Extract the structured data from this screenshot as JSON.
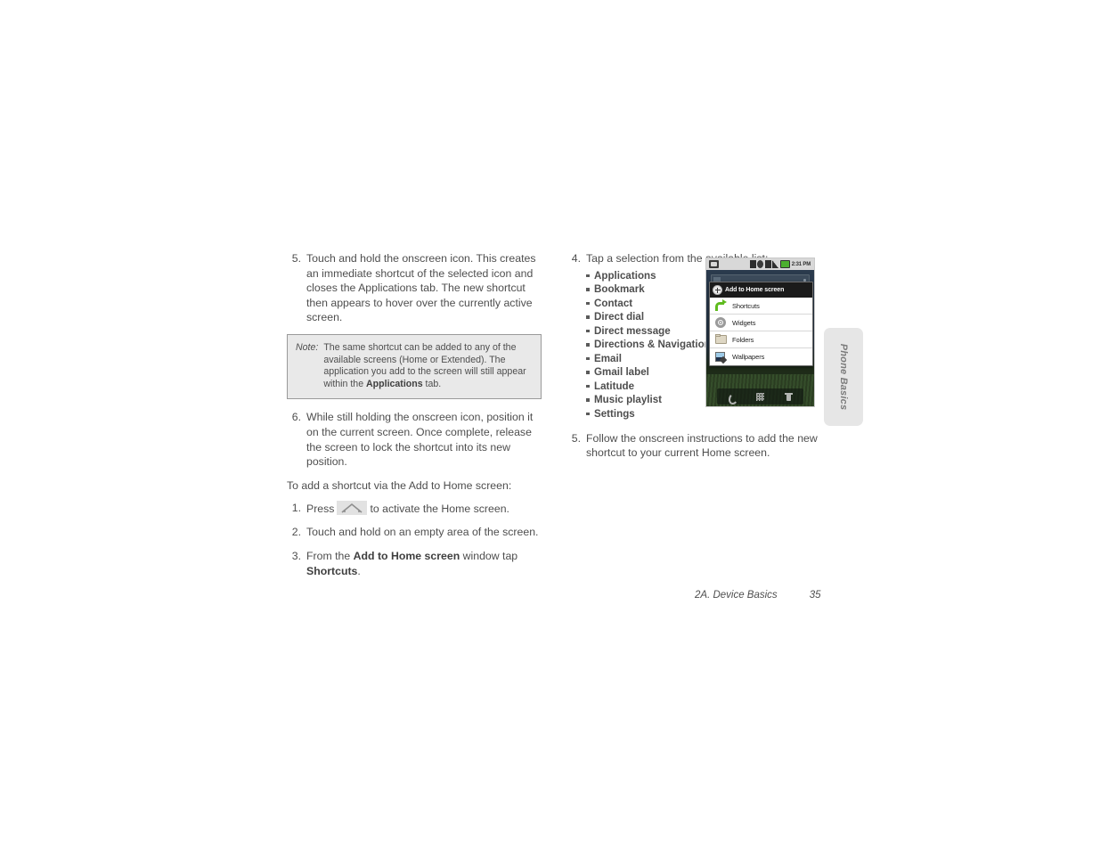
{
  "document": {
    "footer": {
      "chapter": "2A. Device Basics",
      "page_number": "35"
    },
    "side_tab": {
      "label": "Phone Basics"
    }
  },
  "left_column": {
    "step5": {
      "number": "5.",
      "text": "Touch and hold the onscreen icon. This creates an immediate shortcut of the selected icon and closes the Applications tab. The new shortcut then appears to hover over the currently active screen."
    },
    "note": {
      "label": "Note:",
      "text_part1": "The same shortcut can be added to any of the available screens (Home or Extended). The application you add to the screen will still appear within the ",
      "bold_term": "Applications",
      "text_part2": " tab."
    },
    "step6": {
      "number": "6.",
      "text": "While still holding the onscreen icon, position it on the current screen. Once complete, release the screen to lock the shortcut into its new position."
    },
    "lead_in": "To add a shortcut via the Add to Home screen:",
    "step1": {
      "number": "1.",
      "text_before": "Press",
      "icon_name": "home-key-icon",
      "text_after": "to activate the Home screen."
    },
    "step2": {
      "number": "2.",
      "text": "Touch and hold on an empty area of the screen."
    },
    "step3": {
      "number": "3.",
      "text_before": "From the ",
      "bold_1": "Add to Home screen",
      "text_mid": " window tap ",
      "bold_2": "Shortcuts",
      "text_after": "."
    }
  },
  "right_column": {
    "step4": {
      "number": "4.",
      "text": "Tap a selection from the available list:",
      "items": [
        "Applications",
        "Bookmark",
        "Contact",
        "Direct dial",
        "Direct message",
        "Directions & Navigation",
        "Email",
        "Gmail label",
        "Latitude",
        "Music playlist",
        "Settings"
      ]
    },
    "step5": {
      "number": "5.",
      "text": "Follow the onscreen instructions to add the new shortcut to your current Home screen."
    }
  },
  "phone_screenshot": {
    "status_bar": {
      "time": "2:31 PM",
      "icons": [
        "notification-icon",
        "bluetooth-icon",
        "gps-icon",
        "alarm-icon",
        "signal-icon",
        "battery-icon"
      ]
    },
    "dialog": {
      "title": "Add to Home screen",
      "title_icon": "add-plus-icon",
      "rows": [
        {
          "label": "Shortcuts",
          "icon": "shortcut-arrow-icon"
        },
        {
          "label": "Widgets",
          "icon": "widgets-gear-icon"
        },
        {
          "label": "Folders",
          "icon": "folder-icon"
        },
        {
          "label": "Wallpapers",
          "icon": "wallpaper-picture-icon"
        }
      ]
    },
    "dock": {
      "items": [
        "phone-icon",
        "app-grid-icon",
        "browser-icon"
      ]
    }
  },
  "colors": {
    "text": "#4e4e4e",
    "note_bg": "#e9e9e9",
    "note_border": "#9a9a9a",
    "tab_bg": "#e6e6e6",
    "tab_text": "#7b7b7b",
    "accent_green": "#5fbb1e"
  }
}
